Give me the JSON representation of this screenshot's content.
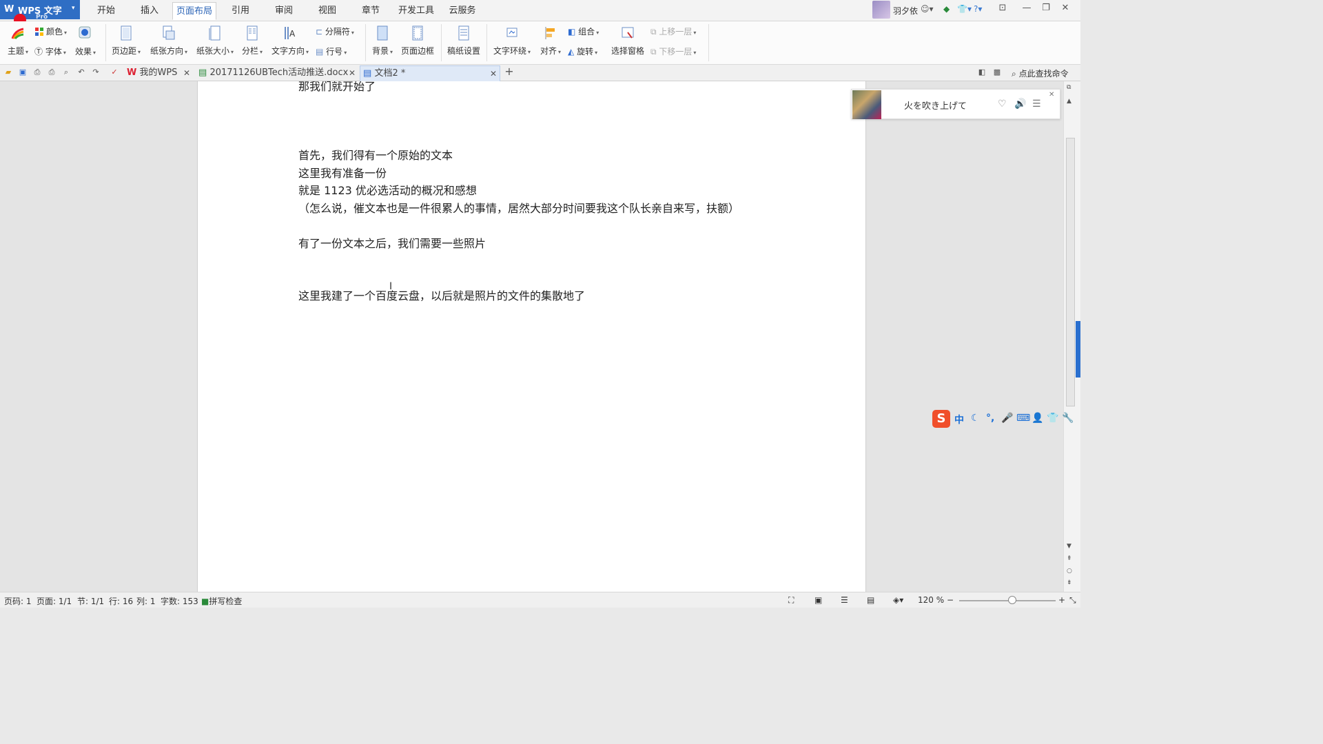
{
  "app": {
    "name": "WPS 文字",
    "edition": "Pro"
  },
  "menu": {
    "tabs": [
      {
        "label": "开始"
      },
      {
        "label": "插入"
      },
      {
        "label": "页面布局"
      },
      {
        "label": "引用"
      },
      {
        "label": "审阅"
      },
      {
        "label": "视图"
      },
      {
        "label": "章节"
      },
      {
        "label": "开发工具"
      },
      {
        "label": "云服务"
      }
    ],
    "active_tab": "页面布局"
  },
  "user": {
    "name": "羽夕依"
  },
  "ribbon": {
    "theme": "主题",
    "color": "颜色",
    "font": "字体",
    "effect": "效果",
    "margin": "页边距",
    "orientation": "纸张方向",
    "size": "纸张大小",
    "columns": "分栏",
    "text_direction": "文字方向",
    "separator": "分隔符",
    "line_no": "行号",
    "background": "背景",
    "page_border": "页面边框",
    "manuscript": "稿纸设置",
    "wrap": "文字环绕",
    "align": "对齐",
    "group": "组合",
    "rotate": "旋转",
    "selection_pane": "选择窗格",
    "bring_forward": "上移一层",
    "send_backward": "下移一层"
  },
  "doc_tabs": [
    {
      "label": "我的WPS"
    },
    {
      "label": "20171126UBTech活动推送.docx"
    },
    {
      "label": "文档2 *"
    }
  ],
  "find_command": "点此查找命令",
  "document": {
    "lines": [
      "那我们就开始了",
      "首先，我们得有一个原始的文本",
      "这里我有准备一份",
      "就是 1123 优必选活动的概况和感想",
      "（怎么说，催文本也是一件很累人的事情，居然大部分时间要我这个队长亲自来写，扶额）",
      "有了一份文本之后，我们需要一些照片",
      "这里我建了一个百度云盘，以后就是照片的文件的集散地了"
    ]
  },
  "music_widget": {
    "song": "火を吹き上げて"
  },
  "ime": {
    "mode": "中"
  },
  "status": {
    "page_no": "页码: 1",
    "pages": "页面: 1/1",
    "section": "节: 1/1",
    "row": "行: 16",
    "col": "列: 1",
    "words": "字数: 153",
    "spell": "拼写检查",
    "zoom": "120 %",
    "zoom_level": 0.55
  }
}
